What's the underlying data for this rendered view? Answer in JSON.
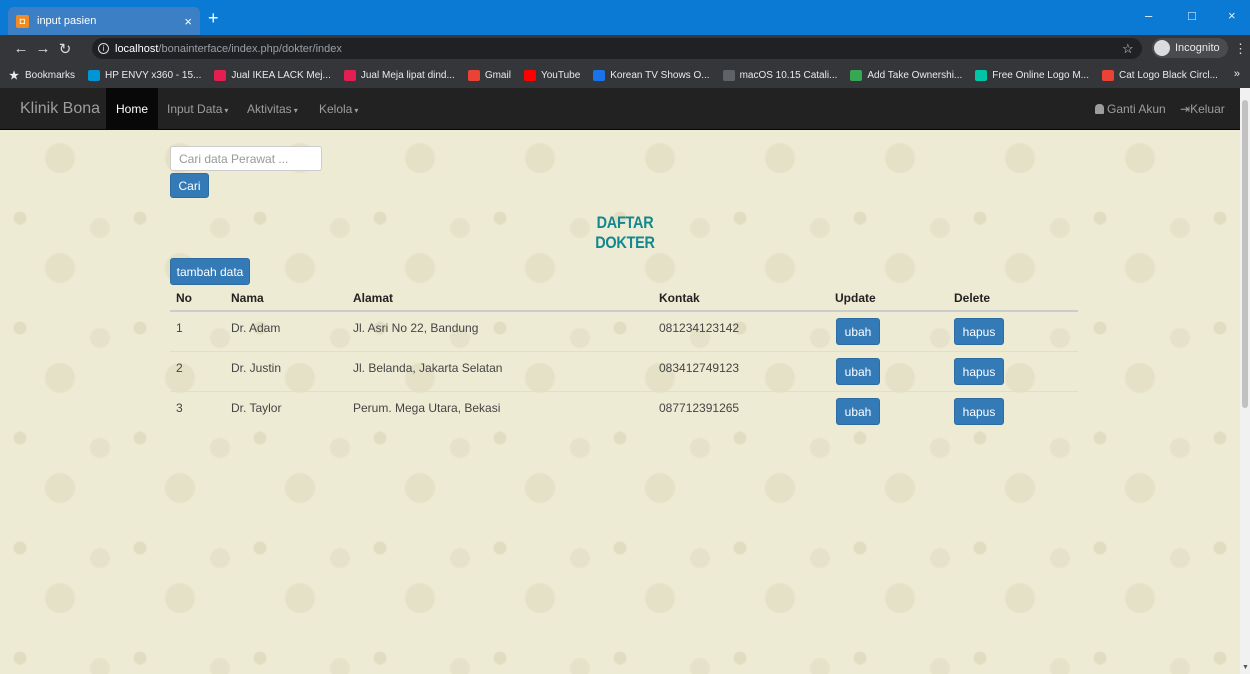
{
  "browser": {
    "tab_title": "input pasien",
    "tab_close": "×",
    "new_tab": "+",
    "url_host": "localhost",
    "url_path": "/bonainterface/index.php/dokter/index",
    "incognito_label": "Incognito",
    "window_controls": [
      "–",
      "□",
      "×"
    ],
    "bookmarks": [
      {
        "label": "Bookmarks",
        "icon": "star-icon",
        "color": "#f1c40f"
      },
      {
        "label": "HP ENVY x360 - 15...",
        "icon": "hp-icon",
        "color": "#0096d6"
      },
      {
        "label": "Jual IKEA LACK Mej...",
        "icon": "bukalapak-icon",
        "color": "#e31e52"
      },
      {
        "label": "Jual Meja lipat dind...",
        "icon": "bukalapak-icon",
        "color": "#e31e52"
      },
      {
        "label": "Gmail",
        "icon": "gmail-icon",
        "color": "#ea4335"
      },
      {
        "label": "YouTube",
        "icon": "youtube-icon",
        "color": "#ff0000"
      },
      {
        "label": "Korean TV Shows O...",
        "icon": "k-icon",
        "color": "#1a73e8"
      },
      {
        "label": "macOS 10.15 Catali...",
        "icon": "globe-icon",
        "color": "#5f6368"
      },
      {
        "label": "Add Take Ownershi...",
        "icon": "puzzle-icon",
        "color": "#34a853"
      },
      {
        "label": "Free Online Logo M...",
        "icon": "logo-icon",
        "color": "#00c4a7"
      },
      {
        "label": "Cat Logo Black Circl...",
        "icon": "cat-icon",
        "color": "#ea4335"
      }
    ],
    "bookmarks_more": "»"
  },
  "navbar": {
    "brand": "Klinik Bona",
    "items": [
      {
        "label": "Home",
        "active": true
      },
      {
        "label": "Input Data",
        "dropdown": true
      },
      {
        "label": "Aktivitas",
        "dropdown": true
      },
      {
        "label": "Kelola",
        "dropdown": true
      }
    ],
    "caret": "▾",
    "account_label": "Ganti Akun",
    "logout_label": "Keluar"
  },
  "search": {
    "placeholder": "Cari data Perawat ...",
    "button_label": "Cari"
  },
  "page_title": "DAFTAR DOKTER",
  "add_button_label": "tambah data",
  "table": {
    "headers": [
      "No",
      "Nama",
      "Alamat",
      "Kontak",
      "Update",
      "Delete"
    ],
    "rows": [
      {
        "no": "1",
        "nama": "Dr. Adam",
        "alamat": "Jl. Asri No 22, Bandung",
        "kontak": "081234123142",
        "update": "ubah",
        "delete": "hapus"
      },
      {
        "no": "2",
        "nama": "Dr. Justin",
        "alamat": "Jl. Belanda, Jakarta Selatan",
        "kontak": "083412749123",
        "update": "ubah",
        "delete": "hapus"
      },
      {
        "no": "3",
        "nama": "Dr. Taylor",
        "alamat": "Perum. Mega Utara, Bekasi",
        "kontak": "087712391265",
        "update": "ubah",
        "delete": "hapus"
      }
    ]
  },
  "colors": {
    "accent": "#337ab7",
    "title": "#13878f",
    "navbar": "#222222",
    "background": "#eeebd4"
  }
}
